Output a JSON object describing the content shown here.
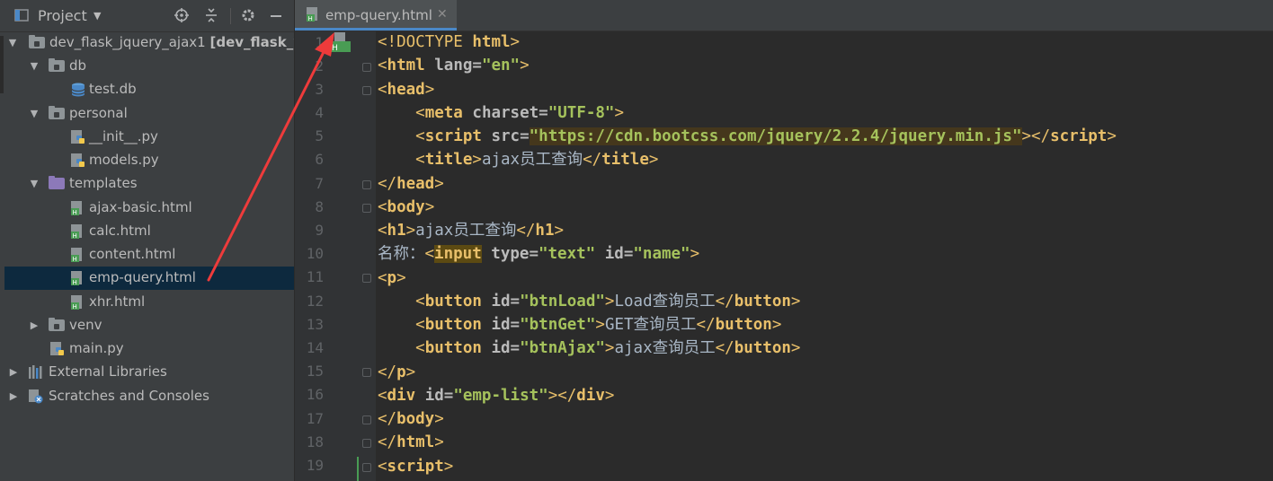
{
  "project_panel": {
    "title": "Project",
    "tree": [
      {
        "label": "dev_flask_jquery_ajax1",
        "suffix": "[dev_flask_we",
        "type": "root-folder",
        "expanded": true
      },
      {
        "label": "db",
        "type": "folder",
        "expanded": true
      },
      {
        "label": "test.db",
        "type": "database-file"
      },
      {
        "label": "personal",
        "type": "folder",
        "expanded": true
      },
      {
        "label": "__init__.py",
        "type": "python-file"
      },
      {
        "label": "models.py",
        "type": "python-file"
      },
      {
        "label": "templates",
        "type": "templates-folder",
        "expanded": true
      },
      {
        "label": "ajax-basic.html",
        "type": "html-file"
      },
      {
        "label": "calc.html",
        "type": "html-file"
      },
      {
        "label": "content.html",
        "type": "html-file"
      },
      {
        "label": "emp-query.html",
        "type": "html-file",
        "selected": true
      },
      {
        "label": "xhr.html",
        "type": "html-file"
      },
      {
        "label": "venv",
        "type": "folder",
        "expanded": false
      },
      {
        "label": "main.py",
        "type": "python-file"
      },
      {
        "label": "External Libraries",
        "type": "libraries",
        "expanded": false
      },
      {
        "label": "Scratches and Consoles",
        "type": "scratches",
        "expanded": false
      }
    ]
  },
  "editor": {
    "tab_label": "emp-query.html",
    "line_numbers": [
      "1",
      "2",
      "3",
      "4",
      "5",
      "6",
      "7",
      "8",
      "9",
      "10",
      "11",
      "12",
      "13",
      "14",
      "15",
      "16",
      "17",
      "18",
      "19"
    ],
    "code": {
      "l1_doctype": "<!DOCTYPE",
      "l1_html": "html",
      "l2_tag": "html",
      "l2_attr": "lang",
      "l2_val": "\"en\"",
      "l3_tag": "head",
      "l4_tag": "meta",
      "l4_attr": "charset",
      "l4_val": "\"UTF-8\"",
      "l5_tag": "script",
      "l5_attr": "src",
      "l5_val": "\"https://cdn.bootcss.com/jquery/2.2.4/jquery.min.js\"",
      "l6_tag": "title",
      "l6_text": "ajax员工查询",
      "l7_tag": "head",
      "l8_tag": "body",
      "l9_tag": "h1",
      "l9_text": "ajax员工查询",
      "l10_text": "名称：",
      "l10_tag": "input",
      "l10_attr1": "type",
      "l10_val1": "\"text\"",
      "l10_attr2": "id",
      "l10_val2": "\"name\"",
      "l11_tag": "p",
      "l12_tag": "button",
      "l12_attr": "id",
      "l12_val": "\"btnLoad\"",
      "l12_text": "Load查询员工",
      "l13_tag": "button",
      "l13_attr": "id",
      "l13_val": "\"btnGet\"",
      "l13_text": "GET查询员工",
      "l14_tag": "button",
      "l14_attr": "id",
      "l14_val": "\"btnAjax\"",
      "l14_text": "ajax查询员工",
      "l15_tag": "p",
      "l16_tag": "div",
      "l16_attr": "id",
      "l16_val": "\"emp-list\"",
      "l17_tag": "body",
      "l18_tag": "html",
      "l19_tag": "script"
    }
  },
  "colors": {
    "panel_bg": "#3c3f41",
    "editor_bg": "#2b2b2b",
    "tag": "#e8bf6a",
    "attr_value": "#a5c25c",
    "selection": "#0d293e",
    "annotation_arrow": "#ee3b3b"
  }
}
